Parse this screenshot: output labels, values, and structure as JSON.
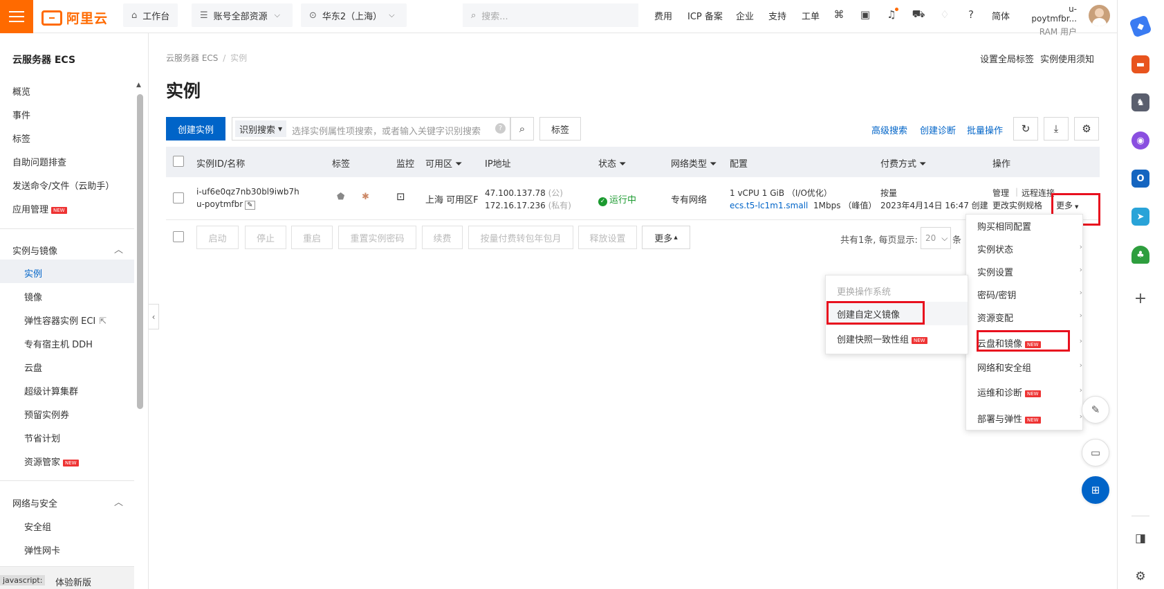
{
  "topbar": {
    "logo_text": "阿里云",
    "workbench": "工作台",
    "resources": "账号全部资源",
    "region": "华东2（上海）",
    "search_placeholder": "搜索...",
    "nav": [
      "费用",
      "ICP 备案",
      "企业",
      "支持",
      "工单"
    ],
    "lang": "简体",
    "user_name": "u-poytmfbr...",
    "user_role": "RAM 用户"
  },
  "sidebar": {
    "title": "云服务器 ECS",
    "top_items": [
      "概览",
      "事件",
      "标签",
      "自助问题排查",
      "发送命令/文件（云助手）",
      "应用管理"
    ],
    "group1_title": "实例与镜像",
    "group1_items": [
      "实例",
      "镜像",
      "弹性容器实例 ECI",
      "专有宿主机 DDH",
      "云盘",
      "超级计算集群",
      "预留实例券",
      "节省计划",
      "资源管家"
    ],
    "group2_title": "网络与安全",
    "group2_items": [
      "安全组",
      "弹性网卡"
    ],
    "bottom_link": "体验新版",
    "bottom_tooltip": "javascript:",
    "new_badge": "NEW"
  },
  "main": {
    "breadcrumb_root": "云服务器 ECS",
    "breadcrumb_sep": "/",
    "breadcrumb_current": "实例",
    "top_right_links": [
      "设置全局标签",
      "实例使用须知"
    ],
    "page_title": "实例",
    "create_btn": "创建实例",
    "search_mode": "识别搜索",
    "search_placeholder": "选择实例属性项搜索，或者输入关键字识别搜索",
    "tag_btn": "标签",
    "right_links": [
      "高级搜索",
      "创建诊断",
      "批量操作"
    ],
    "columns": [
      "实例ID/名称",
      "标签",
      "监控",
      "可用区",
      "IP地址",
      "状态",
      "网络类型",
      "配置",
      "付费方式",
      "操作"
    ],
    "row": {
      "id": "i-uf6e0qz7nb30bl9iwb7h",
      "name": "u-poytmfbr",
      "zone": "上海 可用区F",
      "ip_public": "47.100.137.78",
      "ip_public_tag": "(公)",
      "ip_private": "172.16.17.236",
      "ip_private_tag": "(私有)",
      "status": "运行中",
      "network": "专有网络",
      "config_line1": "1 vCPU 1 GiB （I/O优化）",
      "config_spec": "ecs.t5-lc1m1.small",
      "config_bw": "1Mbps （峰值）",
      "pay_type": "按量",
      "pay_time": "2023年4月14日 16:47 创建",
      "op_manage": "管理",
      "op_remote": "远程连接",
      "op_change": "更改实例规格",
      "op_more": "更多"
    },
    "bulk_buttons": [
      "启动",
      "停止",
      "重启",
      "重置实例密码",
      "续费",
      "按量付费转包年包月",
      "释放设置"
    ],
    "bulk_more": "更多",
    "pagination_text": "共有1条, 每页显示:",
    "page_size": "20",
    "page_unit": "条"
  },
  "more_menu": {
    "items": [
      "购买相同配置",
      "实例状态",
      "实例设置",
      "密码/密钥",
      "资源变配",
      "云盘和镜像",
      "网络和安全组",
      "运维和诊断",
      "部署与弹性"
    ]
  },
  "sub_menu": {
    "items": [
      "更换操作系统",
      "创建自定义镜像",
      "创建快照一致性组"
    ]
  },
  "colors": {
    "accent": "#ff6a00",
    "primary": "#0064c8",
    "highlight": "#e8101e",
    "running": "#1b9a2f"
  }
}
